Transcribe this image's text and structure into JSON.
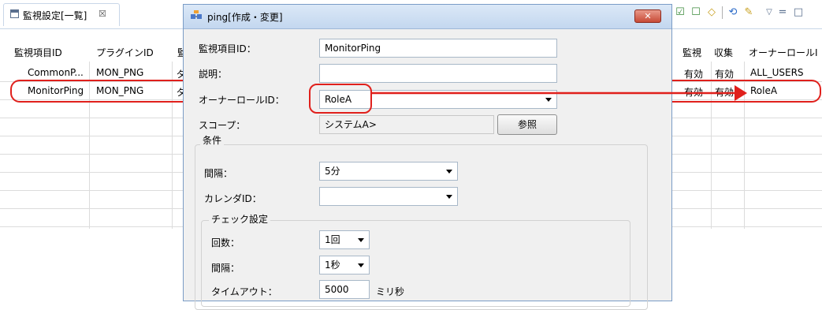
{
  "view": {
    "tab_title": "監視設定[一覧]",
    "tab_close": "☒",
    "columns_left": [
      "監視項目ID",
      "プラグインID",
      "監"
    ],
    "columns_right": [
      "監視",
      "収集",
      "オーナーロールI"
    ],
    "rows": [
      {
        "id": "CommonP...",
        "plugin": "MON_PNG",
        "cut": "ダ",
        "monitor": "有効",
        "collect": "有効",
        "owner": "ALL_USERS"
      },
      {
        "id": "MonitorPing",
        "plugin": "MON_PNG",
        "cut": "ダ",
        "monitor": "有効",
        "collect": "有効",
        "owner": "RoleA"
      }
    ],
    "toolbar_icons": [
      "checkbox-checked-icon",
      "checkbox-empty-icon",
      "add-icon",
      "refresh-icon",
      "pin-icon",
      "view-menu-icon",
      "minimize-icon",
      "maximize-icon"
    ]
  },
  "dialog": {
    "title": "ping[作成・変更]",
    "close_label": "✕",
    "monitor_id_label": "監視項目ID：",
    "monitor_id_value": "MonitorPing",
    "description_label": "説明：",
    "description_value": "",
    "owner_role_label": "オーナーロールID：",
    "owner_role_value": "RoleA",
    "scope_label": "スコープ：",
    "scope_value": "システムA>",
    "scope_button": "参照",
    "condition_group": "条件",
    "interval_label": "間隔：",
    "interval_value": "5分",
    "calendar_label": "カレンダID：",
    "calendar_value": "",
    "check_group": "チェック設定",
    "count_label": "回数：",
    "count_value": "1回",
    "check_interval_label": "間隔：",
    "check_interval_value": "1秒",
    "timeout_label": "タイムアウト：",
    "timeout_value": "5000",
    "timeout_unit": "ミリ秒"
  },
  "colors": {
    "highlight": "#e0201c",
    "titlebar": "#c3d7ef",
    "close": "#c74a36"
  }
}
